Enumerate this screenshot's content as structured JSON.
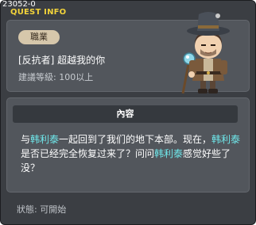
{
  "title_bar": {
    "quest_id": "23052-0",
    "title": "QUEST INFO"
  },
  "quest": {
    "job_label": "職業",
    "name": "[反抗者] 超越我的你",
    "level_requirement": "建議等級: 100以上"
  },
  "content": {
    "header": "內容",
    "description": [
      {
        "text": "与",
        "highlight": false
      },
      {
        "text": "韩利泰",
        "highlight": true
      },
      {
        "text": "一起回到了我们的地下本部。现在，",
        "highlight": false
      },
      {
        "text": "韩利泰",
        "highlight": true
      },
      {
        "text": "是否已经完全恢复过来了？问问",
        "highlight": false
      },
      {
        "text": "韩利泰",
        "highlight": true
      },
      {
        "text": "感觉好些了没？",
        "highlight": false
      }
    ]
  },
  "status": "狀態:  可開始",
  "colors": {
    "title_yellow": "#f2d33a",
    "highlight_cyan": "#6fe7ea",
    "job_badge": "#d6c7ab"
  }
}
